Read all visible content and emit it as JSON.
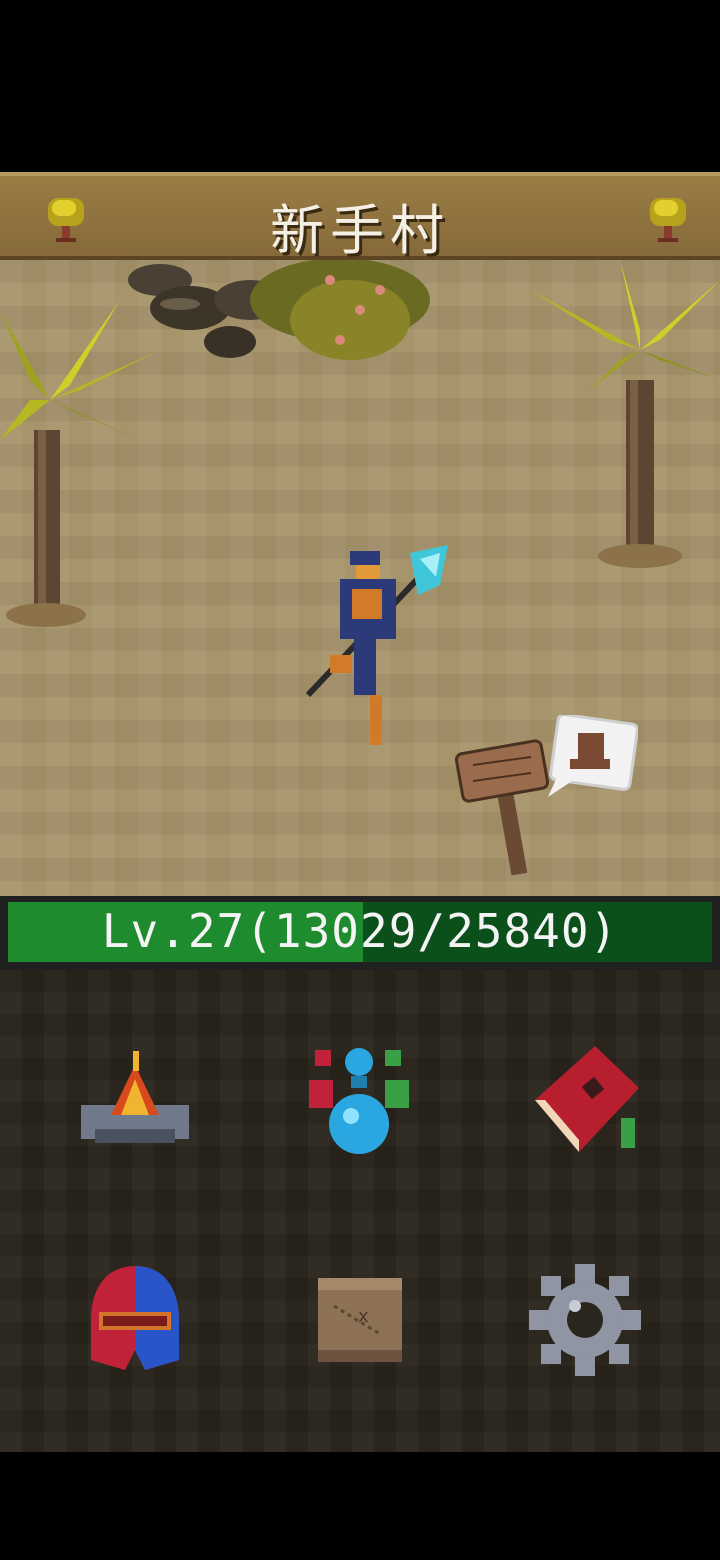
{
  "header": {
    "location_name": "新手村",
    "left_icon": "tree-icon",
    "right_icon": "tree-icon"
  },
  "scene": {
    "objects": [
      "palm-tree",
      "palm-tree",
      "rocks",
      "bush",
      "player-character",
      "signpost",
      "quest-bubble"
    ]
  },
  "xp": {
    "label": "Lv.27(13029/25840)",
    "level": 27,
    "current": 13029,
    "max": 25840,
    "fill_color": "#1f8b2f",
    "bg_color": "#0b4f1b"
  },
  "menu": {
    "items": [
      {
        "icon": "campfire-icon"
      },
      {
        "icon": "potion-icon"
      },
      {
        "icon": "spellbook-icon"
      },
      {
        "icon": "helmet-icon"
      },
      {
        "icon": "map-icon"
      },
      {
        "icon": "gear-icon"
      }
    ]
  }
}
